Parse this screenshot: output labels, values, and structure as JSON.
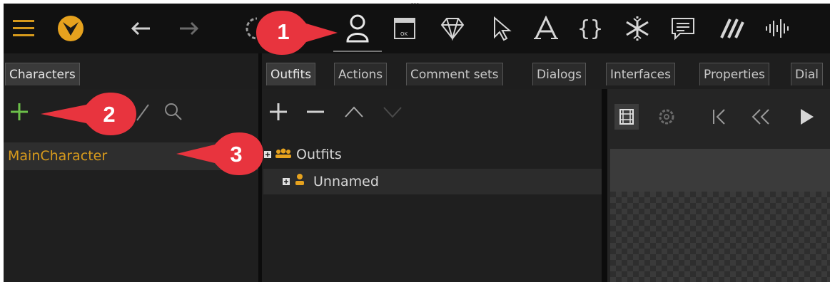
{
  "caption_fragment": "...",
  "toolbar": {
    "icons": [
      "menu-icon",
      "logo-icon",
      "back-arrow-icon",
      "forward-arrow-icon",
      "gear-icon",
      "person-icon",
      "window-icon",
      "diamond-icon",
      "cursor-icon",
      "font-icon",
      "braces-icon",
      "snowflake-icon",
      "speech-icon",
      "stripes-icon",
      "waveform-icon"
    ]
  },
  "left_tabs": [
    {
      "label": "Characters"
    }
  ],
  "main_tabs": [
    {
      "label": "Outfits"
    },
    {
      "label": "Actions"
    },
    {
      "label": "Comment sets"
    },
    {
      "label": "Dialogs"
    },
    {
      "label": "Interfaces"
    },
    {
      "label": "Properties"
    },
    {
      "label": "Dial"
    }
  ],
  "characters": [
    {
      "name": "MainCharacter"
    }
  ],
  "outfits_tree": [
    {
      "label": "Outfits",
      "level": 0
    },
    {
      "label": "Unnamed",
      "level": 1
    }
  ],
  "callouts": [
    {
      "number": "1"
    },
    {
      "number": "2"
    },
    {
      "number": "3"
    }
  ],
  "colors": {
    "accent_orange": "#d79a1c",
    "add_green": "#6cc04a",
    "callout_red": "#e8343e",
    "background": "#1e1e1e"
  }
}
